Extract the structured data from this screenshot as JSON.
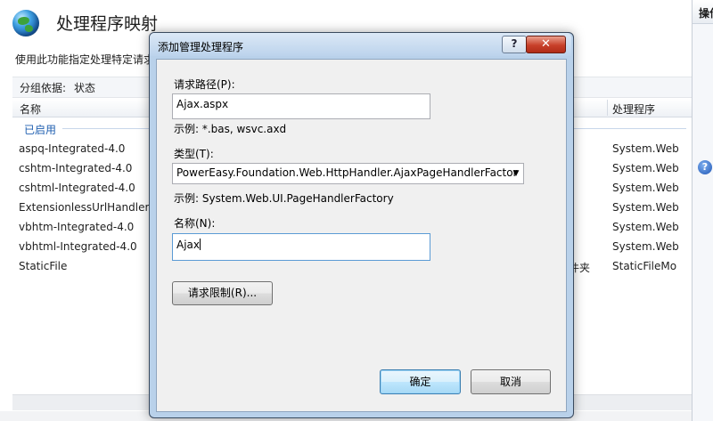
{
  "page": {
    "title": "处理程序映射",
    "description": "使用此功能指定处理特定请求",
    "groupby_label": "分组依据:",
    "groupby_value": "状态",
    "columns": {
      "name": "名称",
      "handler": "处理程序"
    },
    "group_enabled": "已启用",
    "path_type_tail": "件夹",
    "rows": [
      {
        "name": "aspq-Integrated-4.0",
        "handler": "System.Web"
      },
      {
        "name": "cshtm-Integrated-4.0",
        "handler": "System.Web"
      },
      {
        "name": "cshtml-Integrated-4.0",
        "handler": "System.Web"
      },
      {
        "name": "ExtensionlessUrlHandler-I",
        "handler": "System.Web"
      },
      {
        "name": "vbhtm-Integrated-4.0",
        "handler": "System.Web"
      },
      {
        "name": "vbhtml-Integrated-4.0",
        "handler": "System.Web"
      },
      {
        "name": "StaticFile",
        "handler": "StaticFileMo"
      }
    ]
  },
  "actions": {
    "title": "操作",
    "help_icon": "?"
  },
  "dialog": {
    "title": "添加管理处理程序",
    "help_button": "?",
    "close_button": "✕",
    "path_label": "请求路径(P):",
    "path_value": "Ajax.aspx",
    "path_example": "示例: *.bas, wsvc.axd",
    "type_label": "类型(T):",
    "type_value": "PowerEasy.Foundation.Web.HttpHandler.AjaxPageHandlerFactor",
    "type_example": "示例: System.Web.UI.PageHandlerFactory",
    "name_label": "名称(N):",
    "name_value": "Ajax",
    "restrictions_button": "请求限制(R)...",
    "ok_button": "确定",
    "cancel_button": "取消"
  },
  "colors": {
    "dialog_frame": "#b9d1ea",
    "dialog_client": "#f0f0f0",
    "close_button": "#c8402a",
    "group_header": "#1f5fb0"
  }
}
